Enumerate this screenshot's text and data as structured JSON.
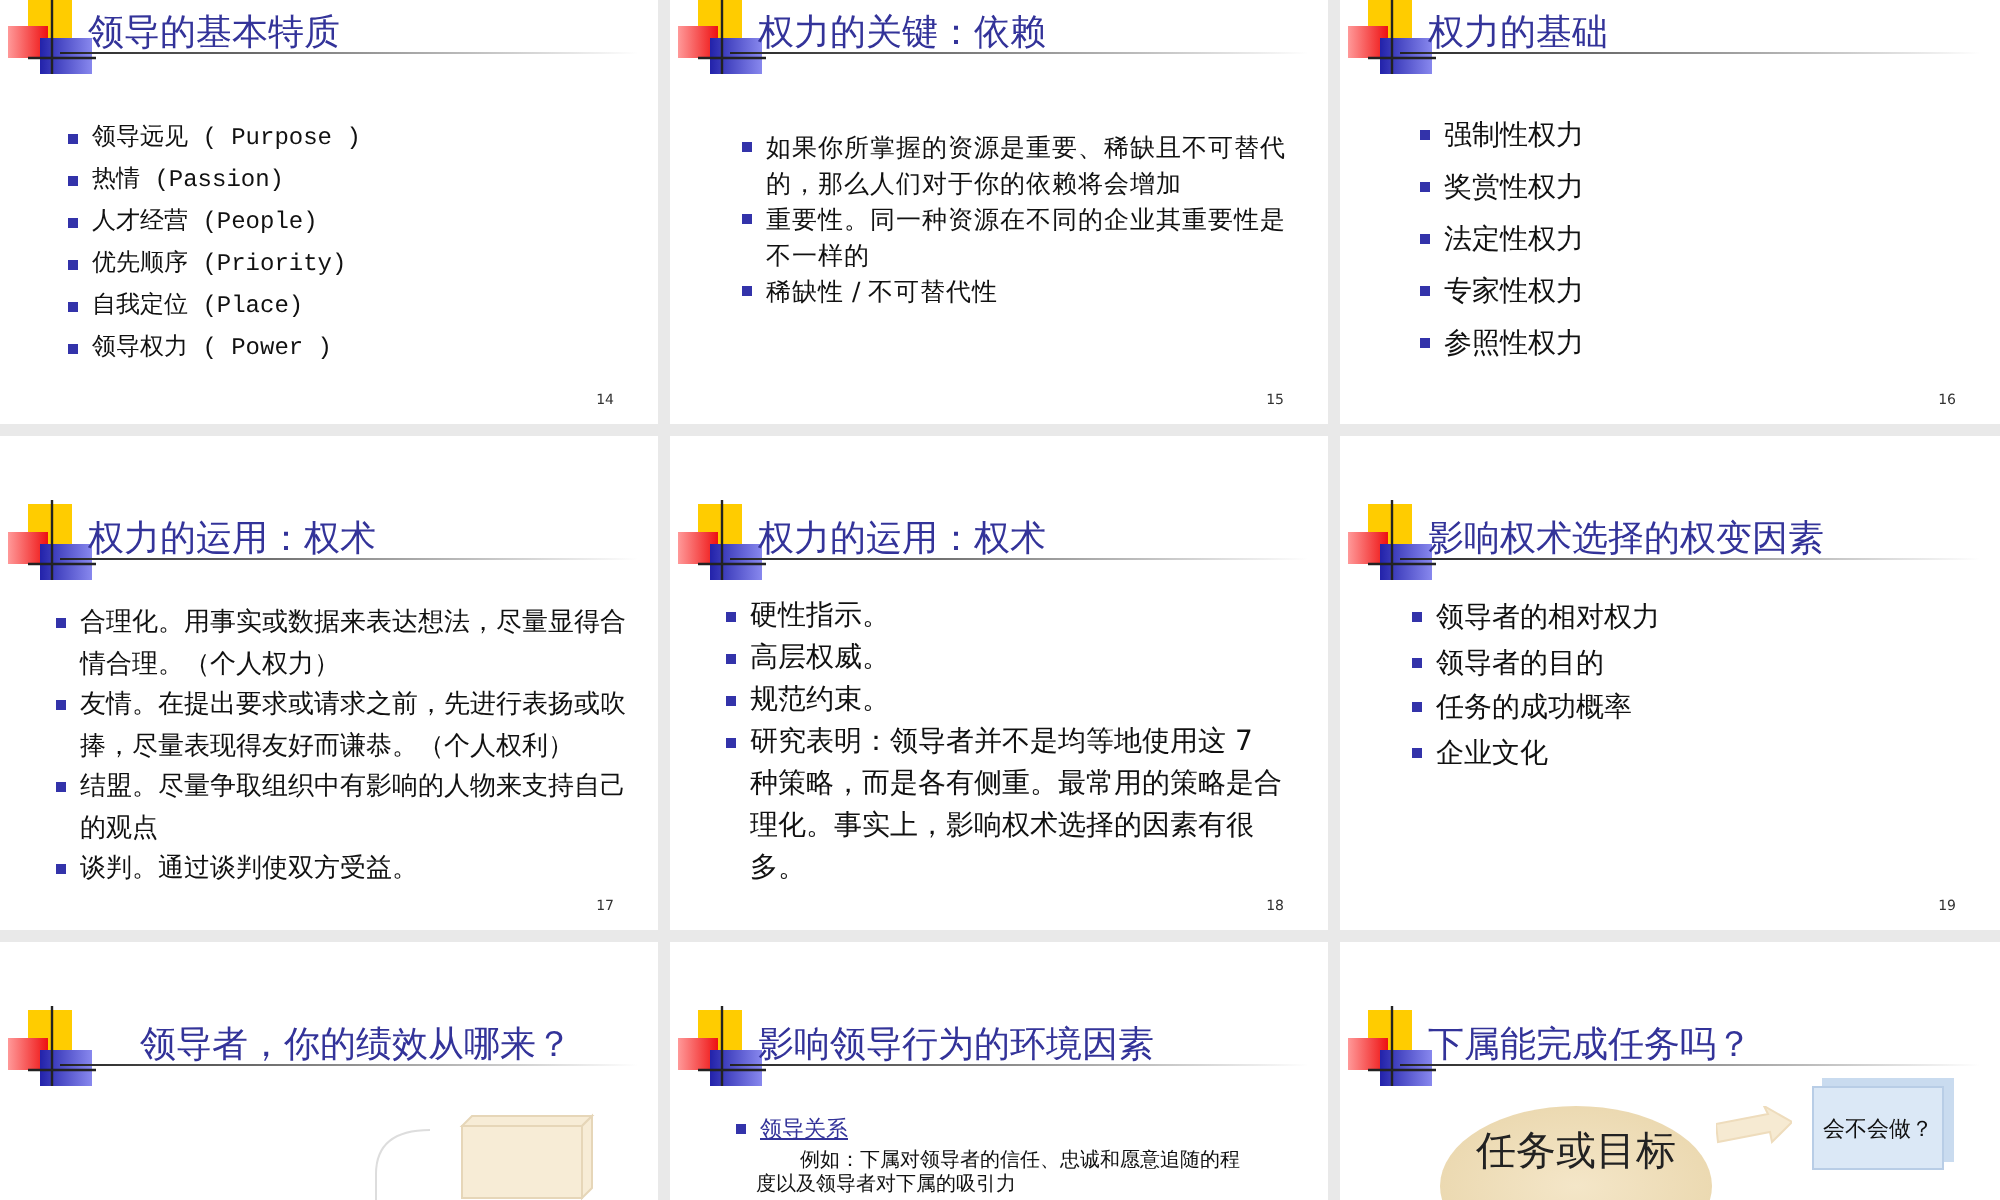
{
  "slides": [
    {
      "kind": "list",
      "number": "14",
      "title": "领导的基本特质",
      "bullets": [
        {
          "text": "领导远见 ( Purpose )"
        },
        {
          "text": "热情 (Passion)"
        },
        {
          "text": "人才经营 (People)"
        },
        {
          "text": "优先顺序 (Priority)"
        },
        {
          "text": "自我定位 (Place)"
        },
        {
          "text": "领导权力 ( Power )"
        }
      ]
    },
    {
      "kind": "list",
      "number": "15",
      "title": "权力的关键：依赖",
      "bullets": [
        {
          "text": "如果你所掌握的资源是重要、稀缺且不可替代的，那么人们对于你的依赖将会增加"
        },
        {
          "text": "重要性。同一种资源在不同的企业其重要性是不一样的"
        },
        {
          "text": "稀缺性 / 不可替代性"
        }
      ]
    },
    {
      "kind": "list",
      "number": "16",
      "title": "权力的基础",
      "bullets": [
        {
          "text": "强制性权力"
        },
        {
          "text": "奖赏性权力"
        },
        {
          "text": "法定性权力"
        },
        {
          "text": "专家性权力"
        },
        {
          "text": "参照性权力"
        }
      ]
    },
    {
      "kind": "list",
      "number": "17",
      "title": "权力的运用：权术",
      "bullets": [
        {
          "text": "合理化。用事实或数据来表达想法，尽量显得合情合理。（个人权力）"
        },
        {
          "text": "友情。在提出要求或请求之前，先进行表扬或吹捧，尽量表现得友好而谦恭。（个人权利）"
        },
        {
          "text": "结盟。尽量争取组织中有影响的人物来支持自己的观点"
        },
        {
          "text": "谈判。通过谈判使双方受益。"
        }
      ]
    },
    {
      "kind": "list",
      "number": "18",
      "title": "权力的运用：权术",
      "bullets": [
        {
          "text": "硬性指示。"
        },
        {
          "text": "高层权威。"
        },
        {
          "text": "规范约束。"
        },
        {
          "text": "研究表明：领导者并不是均等地使用这 7 种策略，而是各有侧重。最常用的策略是合理化。事实上，影响权术选择的因素有很多。"
        }
      ]
    },
    {
      "kind": "list",
      "number": "19",
      "title": "影响权术选择的权变因素",
      "bullets": [
        {
          "text": "领导者的相对权力"
        },
        {
          "text": "领导者的目的"
        },
        {
          "text": "任务的成功概率"
        },
        {
          "text": "企业文化"
        }
      ]
    },
    {
      "kind": "boxes",
      "title": "领导者，你的绩效从哪来？"
    },
    {
      "kind": "links",
      "title": "影响领导行为的环境因素",
      "bullets": [
        {
          "text": "领导关系",
          "note": "例如：下属对领导者的信任、忠诚和愿意追随的程度以及领导者对下属的吸引力"
        }
      ]
    },
    {
      "kind": "task",
      "title": "下属能完成任务吗？",
      "oval": "任务或目标",
      "box": "会不会做？"
    }
  ]
}
